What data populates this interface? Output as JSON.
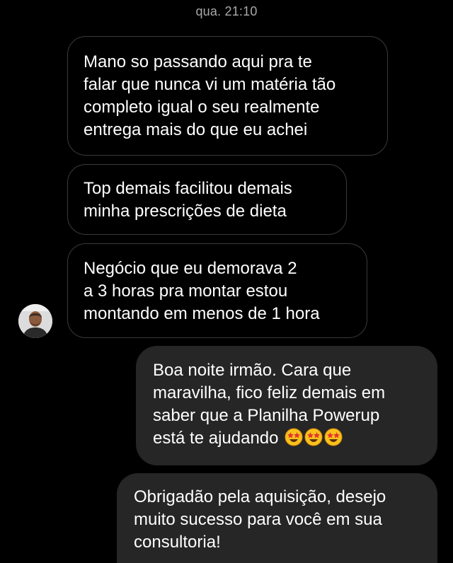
{
  "chat": {
    "timestamp": "qua. 21:10",
    "messages": [
      {
        "direction": "incoming",
        "lines": [
          "Mano so passando aqui pra te",
          "falar que nunca vi um matéria tão",
          "completo igual o seu realmente",
          "entrega mais do que eu achei"
        ]
      },
      {
        "direction": "incoming",
        "lines": [
          "Top demais facilitou demais",
          "minha prescrições de dieta"
        ]
      },
      {
        "direction": "incoming",
        "lines": [
          "Negócio que eu demorava 2",
          "a 3 horas pra montar estou",
          "montando em menos de 1 hora"
        ]
      },
      {
        "direction": "outgoing",
        "lines": [
          "Boa noite irmão. Cara que",
          "maravilha, fico feliz demais em",
          "saber que a Planilha Powerup",
          "está te ajudando"
        ],
        "trailing_emoji": [
          "star-struck-emoji",
          "star-struck-emoji",
          "star-struck-emoji"
        ]
      },
      {
        "direction": "outgoing",
        "lines": [
          "Obrigadão pela aquisição, desejo",
          "muito sucesso para você em sua",
          "consultoria!"
        ]
      }
    ]
  },
  "colors": {
    "background": "#000000",
    "incoming_border": "#3a3a3a",
    "outgoing_fill": "#262626",
    "text": "#ffffff",
    "timestamp": "#a8a8a8"
  }
}
